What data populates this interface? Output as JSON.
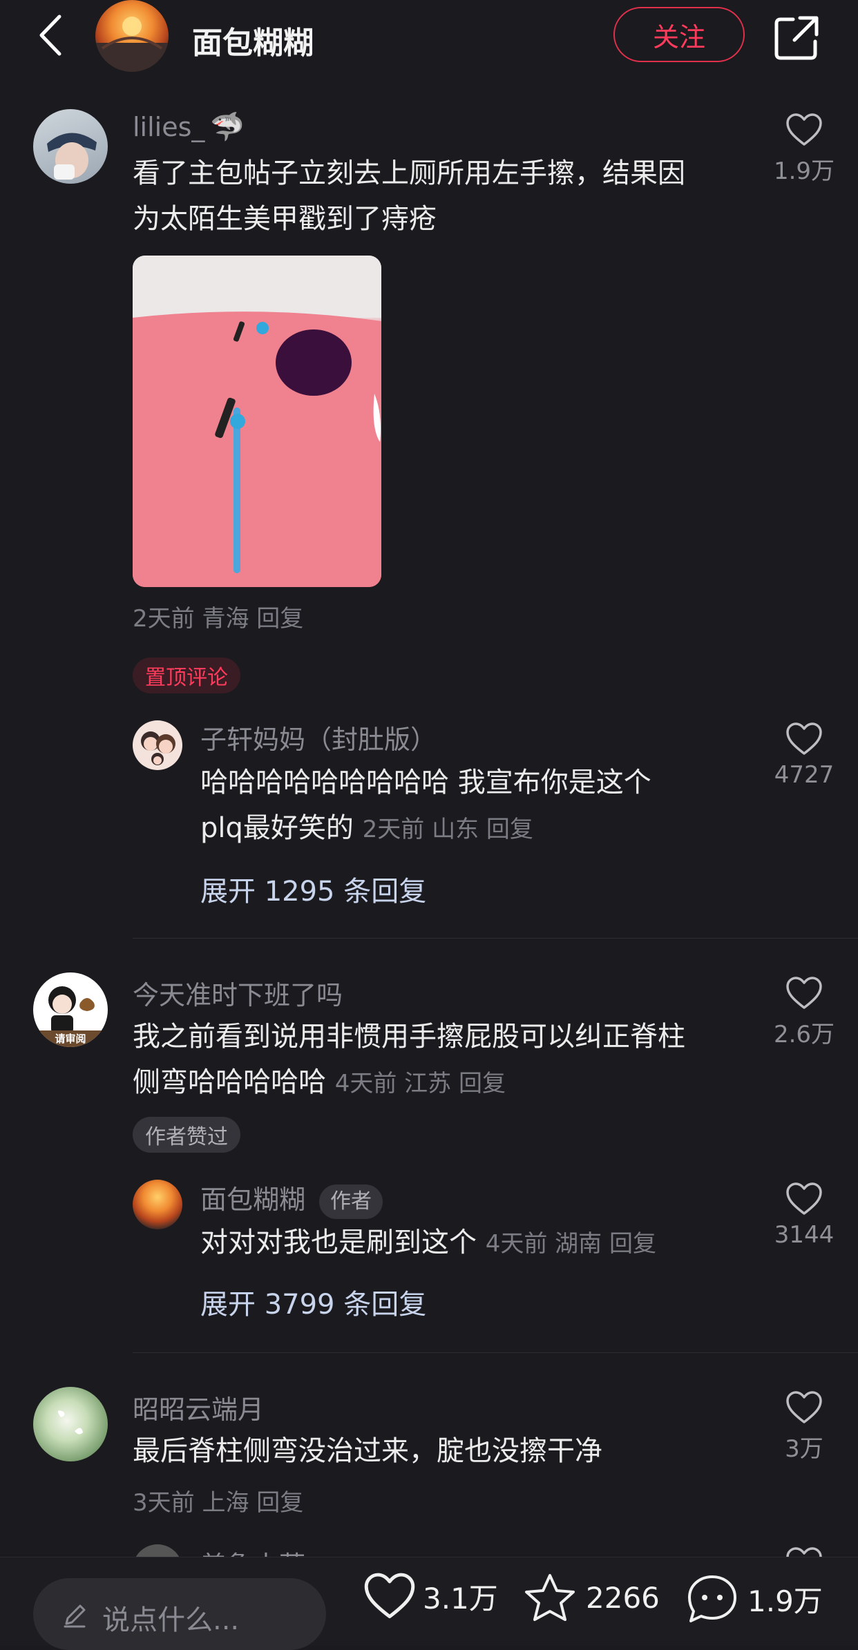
{
  "header": {
    "author_name": "面包糊糊",
    "follow_label": "关注"
  },
  "comments": [
    {
      "username": "lilies_",
      "username_suffix_emoji": "🦈",
      "text_line1": "看了主包帖子立刻去上厕所用左手擦，结果因",
      "text_line2": "为太陌生美甲戳到了痔疮",
      "meta": "2天前 青海 回复",
      "likes": "1.9万",
      "tag": "置顶评论",
      "reply": {
        "username": "子轩妈妈（封肚版）",
        "text_line1": "哈哈哈哈哈哈哈哈哈 我宣布你是这个",
        "text_line2": "plq最好笑的",
        "meta": "2天前 山东 回复",
        "likes": "4727"
      },
      "expand": "展开 1295 条回复"
    },
    {
      "username": "今天准时下班了吗",
      "avatar_caption": "请审阅",
      "text_line1": "我之前看到说用非惯用手擦屁股可以纠正脊柱",
      "text_line2": "侧弯哈哈哈哈哈",
      "meta": "4天前 江苏 回复",
      "likes": "2.6万",
      "tag": "作者赞过",
      "reply": {
        "username": "面包糊糊",
        "badge": "作者",
        "text_line1": "对对对我也是刷到这个",
        "meta": "4天前 湖南 回复",
        "likes": "3144"
      },
      "expand": "展开 3799 条回复"
    },
    {
      "username": "昭昭云端月",
      "text_line1": "最后脊柱侧弯没治过来，腚也没擦干净",
      "meta": "3天前 上海 回复",
      "likes": "3万"
    },
    {
      "username_partial": "普鲁士蓝"
    }
  ],
  "bottom_bar": {
    "input_placeholder": "说点什么...",
    "likes_count": "3.1万",
    "favorites_count": "2266",
    "comments_count": "1.9万"
  },
  "colors": {
    "background": "#1a1a1f",
    "accent_red": "#ff3b5c",
    "expand_blue": "#c8d4ec"
  }
}
